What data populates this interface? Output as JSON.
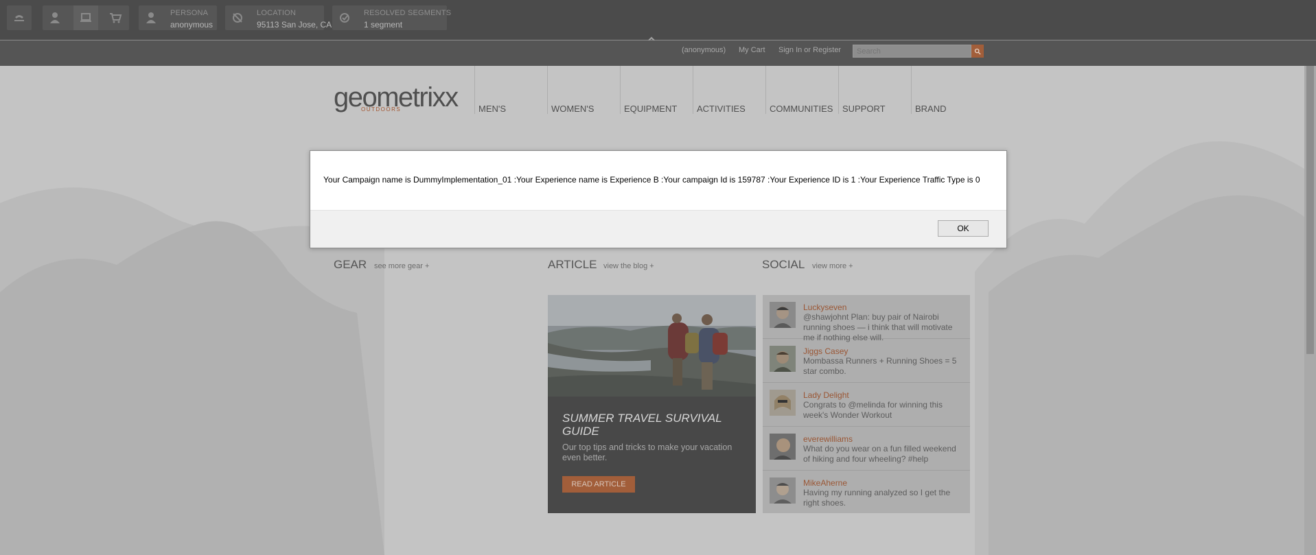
{
  "context_hub": {
    "persona": {
      "label": "PERSONA",
      "value": "anonymous"
    },
    "location": {
      "label": "LOCATION",
      "value": "95113 San Jose, CA"
    },
    "segments": {
      "label": "RESOLVED SEGMENTS",
      "value": "1 segment"
    }
  },
  "utility_nav": {
    "anonymous": "(anonymous)",
    "cart": "My Cart",
    "signin": "Sign In or Register",
    "search_placeholder": "Search"
  },
  "brand": {
    "name": "geometrixx",
    "tagline": "OUTDOORS",
    "accent": "#a25e3a"
  },
  "main_nav": [
    "MEN'S",
    "WOMEN'S",
    "EQUIPMENT",
    "ACTIVITIES",
    "COMMUNITIES",
    "SUPPORT",
    "BRAND"
  ],
  "sections": {
    "gear": {
      "title": "GEAR",
      "more": "see more gear +"
    },
    "article": {
      "title": "ARTICLE",
      "more": "view the blog +"
    },
    "social": {
      "title": "SOCIAL",
      "more": "view more +"
    }
  },
  "article": {
    "title": "SUMMER TRAVEL SURVIVAL GUIDE",
    "description": "Our top tips and tricks to make your vacation even better.",
    "button": "READ ARTICLE"
  },
  "social": [
    {
      "name": "Luckyseven",
      "text": "@shawjohnt Plan: buy pair of Nairobi running shoes — i think that will motivate me if nothing else will."
    },
    {
      "name": "Jiggs Casey",
      "text": "Mombassa Runners + Running Shoes = 5 star combo."
    },
    {
      "name": "Lady Delight",
      "text": "Congrats to @melinda for winning this week's Wonder Workout"
    },
    {
      "name": "everewilliams",
      "text": "What do you wear on a fun filled weekend of hiking and four wheeling? #help"
    },
    {
      "name": "MikeAherne",
      "text": "Having my running analyzed so I get the right shoes."
    }
  ],
  "dialog": {
    "message": "Your Campaign name is DummyImplementation_01 :Your Experience name is Experience B :Your campaign Id is 159787 :Your Experience ID is 1 :Your Experience Traffic Type is 0",
    "ok": "OK"
  }
}
